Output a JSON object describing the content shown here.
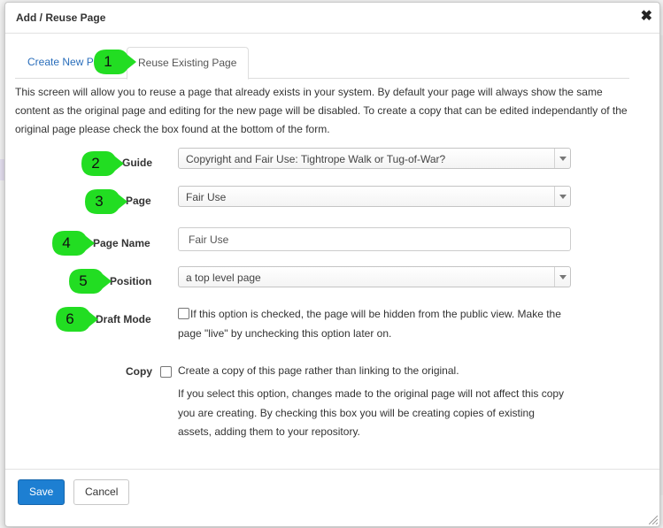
{
  "dialog": {
    "title": "Add / Reuse Page",
    "close_glyph": "✖"
  },
  "tabs": [
    {
      "label": "Create New Page",
      "active": false
    },
    {
      "label": "Reuse Existing Page",
      "active": true
    }
  ],
  "intro_text": "This screen will allow you to reuse a page that already exists in your system. By default your page will always show the same content as the original page and editing for the new page will be disabled. To create a copy that can be edited independantly of the original page please check the box found at the bottom of the form.",
  "form": {
    "guide": {
      "label": "Guide",
      "value": "Copyright and Fair Use: Tightrope Walk or Tug-of-War?"
    },
    "page": {
      "label": "Page",
      "value": "Fair Use"
    },
    "page_name": {
      "label": "Page Name",
      "value": "Fair Use"
    },
    "position": {
      "label": "Position",
      "value": "a top level page"
    },
    "draft_mode": {
      "label": "Draft Mode",
      "checked": false,
      "help_line1": "If this option is checked, the page will be hidden from the public view. Make the",
      "help_line2": "page \"live\" by unchecking this option later on."
    },
    "copy": {
      "label": "Copy",
      "checked": false,
      "option_text": "Create a copy of this page rather than linking to the original.",
      "help_line1": "If you select this option, changes made to the original page will not affect this copy",
      "help_line2": "you are creating. By checking this box you will be creating copies of existing",
      "help_line3": "assets, adding them to your repository."
    }
  },
  "callouts": [
    "1",
    "2",
    "3",
    "4",
    "5",
    "6"
  ],
  "callout_color": "#22dd22",
  "buttons": {
    "save": "Save",
    "cancel": "Cancel"
  },
  "colors": {
    "primary": "#1d7fd2",
    "link": "#2a6ebb"
  }
}
